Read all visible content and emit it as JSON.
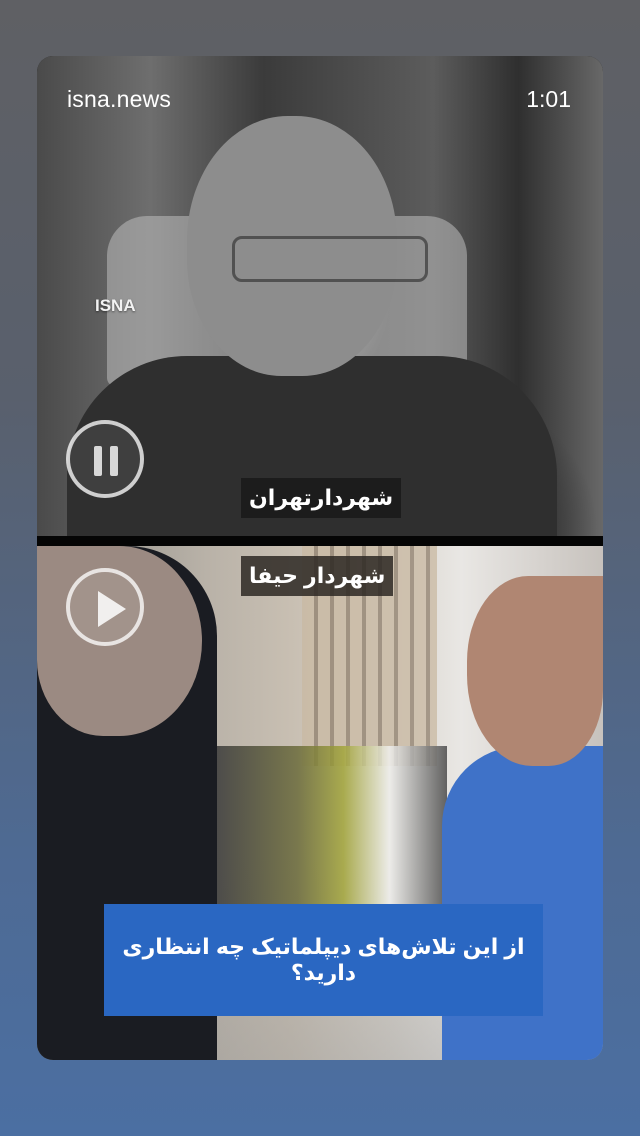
{
  "header": {
    "source": "isna.news",
    "time": "1:01"
  },
  "video_top": {
    "watermark": "ISNA",
    "caption": "شهردارتهران"
  },
  "video_bottom": {
    "caption": "شهردار حیفا",
    "subtitle": "از این تلاش‌های دیپلماتیک چه انتظاری دارید؟"
  },
  "controls": {
    "pause_icon": "pause-icon",
    "play_icon": "play-icon"
  },
  "colors": {
    "subtitle_bg": "#2a67c2",
    "caption_bg": "#1a1a1a"
  }
}
